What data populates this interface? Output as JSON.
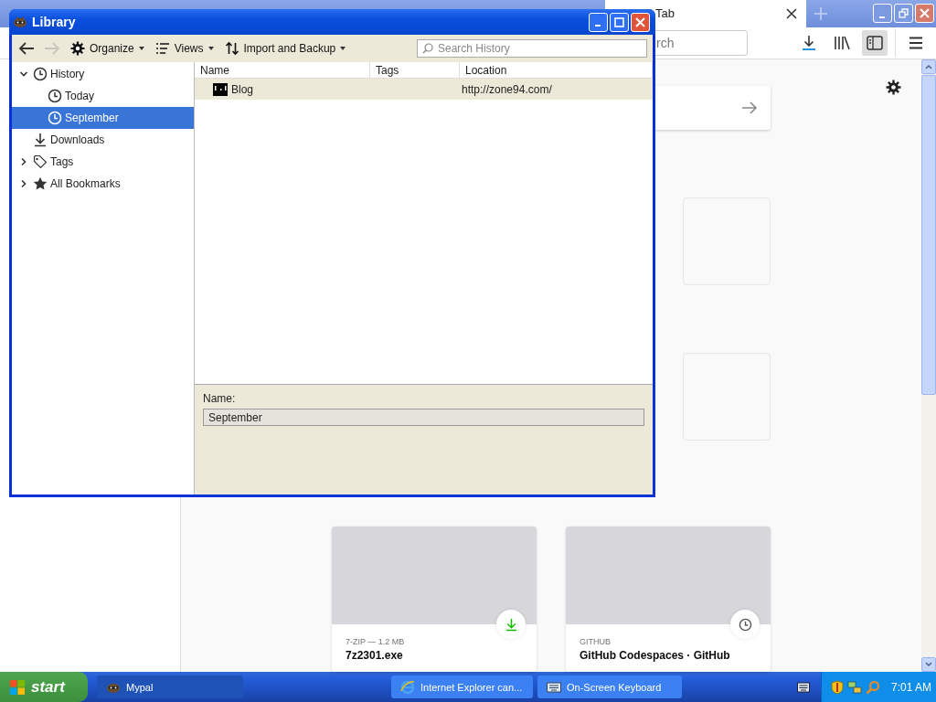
{
  "browser": {
    "tabs": [
      {
        "label": "Tab",
        "selected": true
      }
    ],
    "search": {
      "value": "rch"
    },
    "highlights": [
      {
        "context": "7-ZIP — 1.2 MB",
        "title": "7z2301.exe",
        "kind": "download"
      },
      {
        "context": "GITHUB",
        "title": "GitHub Codespaces · GitHub",
        "kind": "history"
      }
    ]
  },
  "library": {
    "title": "Library",
    "nav": [
      {
        "kind": "back",
        "disabled": false
      },
      {
        "kind": "forward",
        "disabled": true
      }
    ],
    "menus": [
      {
        "label": "Organize",
        "kind": "gear"
      },
      {
        "label": "Views",
        "kind": "list"
      },
      {
        "label": "Import and Backup",
        "kind": "updown"
      }
    ],
    "search": {
      "placeholder": "Search History"
    },
    "tree": [
      {
        "label": "History",
        "kind": "clock",
        "expanded": true,
        "selected": false,
        "children": [
          {
            "label": "Today",
            "kind": "clock",
            "selected": false
          },
          {
            "label": "September",
            "kind": "clock",
            "selected": true
          }
        ]
      },
      {
        "label": "Downloads",
        "kind": "download",
        "selected": false
      },
      {
        "label": "Tags",
        "kind": "tag",
        "expanded": false,
        "selected": false
      },
      {
        "label": "All Bookmarks",
        "kind": "star",
        "expanded": false,
        "selected": false
      }
    ],
    "columns": [
      "Name",
      "Tags",
      "Location"
    ],
    "rows": [
      {
        "name": "Blog",
        "location": "http://zone94.com/",
        "selected": true
      }
    ],
    "details": {
      "label": "Name:",
      "value": "September"
    }
  },
  "taskbar": {
    "start": "start",
    "tasks": [
      {
        "label": "Mypal",
        "kind": "app",
        "selected": true
      },
      {
        "label": "Internet Explorer can...",
        "kind": "ie",
        "selected": false
      },
      {
        "label": "On-Screen Keyboard",
        "kind": "keyboard",
        "selected": false
      }
    ],
    "clock": "7:01 AM"
  }
}
